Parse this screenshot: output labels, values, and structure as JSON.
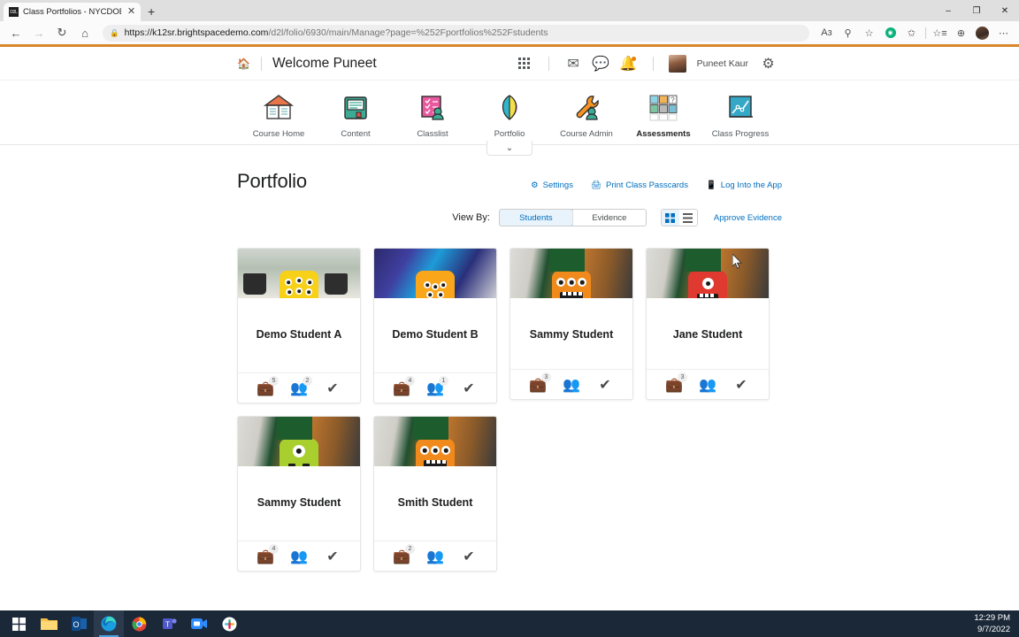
{
  "browser": {
    "tab": {
      "title": "Class Portfolios - NYCDOE Sand",
      "favicon_text": "D2L",
      "close_icon": "close-icon"
    },
    "newtab_label": "+",
    "window_controls": {
      "minimize": "–",
      "maximize": "❐",
      "close": "✕"
    },
    "nav": {
      "back": "←",
      "forward": "→",
      "reload": "↻",
      "home": "⌂"
    },
    "omnibox": {
      "lock_icon": "lock-icon",
      "url_bold": "https://k12sr.brightspacedemo.com",
      "url_dim": "/d2l/folio/6930/main/Manage?page=%252Fportfolios%252Fstudents"
    },
    "toolbar_right": [
      "read-aloud-icon",
      "search-icon",
      "favorites-icon",
      "extension-green-icon",
      "settings-icon",
      "collections-icon",
      "add-extension-icon",
      "profile-avatar",
      "more-icon"
    ]
  },
  "d2l_header": {
    "home_icon": "home-icon",
    "welcome": "Welcome Puneet",
    "icons": [
      "waffle-icon",
      "email-icon",
      "chat-icon",
      "notifications-icon"
    ],
    "user_name": "Puneet Kaur",
    "gear_icon": "gear-icon"
  },
  "navtiles": [
    {
      "label": "Course Home",
      "icon": "course-home-icon",
      "active": false
    },
    {
      "label": "Content",
      "icon": "content-icon",
      "active": false
    },
    {
      "label": "Classlist",
      "icon": "classlist-icon",
      "active": false
    },
    {
      "label": "Portfolio",
      "icon": "portfolio-icon",
      "active": false
    },
    {
      "label": "Course Admin",
      "icon": "course-admin-icon",
      "active": false
    },
    {
      "label": "Assessments",
      "icon": "assessments-icon",
      "active": true
    },
    {
      "label": "Class Progress",
      "icon": "class-progress-icon",
      "active": false
    }
  ],
  "collapse_label": "⌄",
  "main": {
    "title": "Portfolio",
    "actions": [
      {
        "label": "Settings",
        "icon": "gear-icon"
      },
      {
        "label": "Print Class Passcards",
        "icon": "printer-icon"
      },
      {
        "label": "Log Into the App",
        "icon": "mobile-icon"
      }
    ],
    "viewby": {
      "label": "View By:",
      "options": [
        "Students",
        "Evidence"
      ],
      "selected": "Students",
      "grid_icon": "grid-view-icon",
      "list_icon": "list-view-icon",
      "view_mode": "grid",
      "approve_label": "Approve Evidence"
    },
    "students": [
      {
        "name": "Demo Student A",
        "banner": "bn-plants",
        "avatar": "m-y",
        "eyes": 6,
        "portfolio_count": "5",
        "group_count": "2",
        "approved_icon": "check-circle-icon"
      },
      {
        "name": "Demo Student B",
        "banner": "bn-blue",
        "avatar": "m-o",
        "eyes": 5,
        "portfolio_count": "4",
        "group_count": "1",
        "approved_icon": "check-circle-icon"
      },
      {
        "name": "Sammy Student",
        "banner": "bn-dog",
        "avatar": "m-o2",
        "eyes": 3,
        "portfolio_count": "3",
        "group_count": "",
        "approved_icon": "check-circle-icon"
      },
      {
        "name": "Jane Student",
        "banner": "bn-dog",
        "avatar": "m-r",
        "eyes": 1,
        "portfolio_count": "3",
        "group_count": "",
        "approved_icon": "check-circle-icon"
      },
      {
        "name": "Sammy Student",
        "banner": "bn-dog",
        "avatar": "m-g",
        "eyes": 1,
        "portfolio_count": "4",
        "group_count": "",
        "approved_icon": "check-circle-icon"
      },
      {
        "name": "Smith Student",
        "banner": "bn-dog",
        "avatar": "m-o2",
        "eyes": 3,
        "portfolio_count": "2",
        "group_count": "",
        "approved_icon": "check-circle-icon"
      }
    ]
  },
  "taskbar": {
    "items": [
      "start-icon",
      "file-explorer-icon",
      "outlook-icon",
      "edge-icon",
      "chrome-icon",
      "teams-icon",
      "zoom-icon",
      "slack-icon"
    ],
    "active_index": 3,
    "time": "12:29 PM",
    "date": "9/7/2022"
  },
  "colors": {
    "accent": "#006fbf",
    "brand_orange": "#d9862c",
    "taskbar": "#1b2838"
  }
}
